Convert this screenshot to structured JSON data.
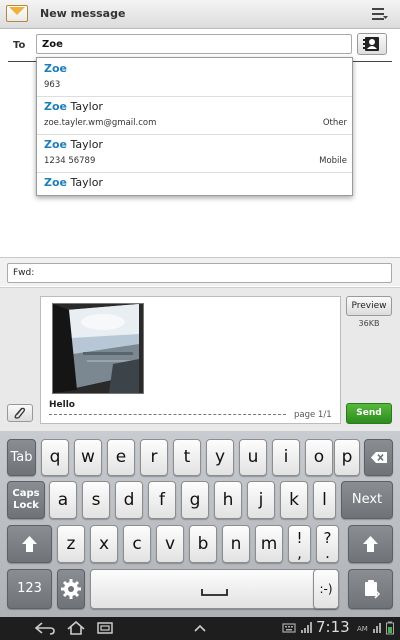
{
  "titlebar": {
    "title": "New message",
    "icon": "envelope-icon",
    "menu_icon": "menu-icon"
  },
  "recipient": {
    "label": "To",
    "value": "Zoe",
    "contacts_icon": "contacts-icon"
  },
  "suggestions": [
    {
      "match": "Zoe",
      "rest": "",
      "detail": "963",
      "type": ""
    },
    {
      "match": "Zoe",
      "rest": " Taylor",
      "detail": "zoe.tayler.wm@gmail.com",
      "type": "Other"
    },
    {
      "match": "Zoe",
      "rest": " Taylor",
      "detail": "1234 56789",
      "type": "Mobile"
    },
    {
      "match": "Zoe",
      "rest": " Taylor",
      "detail": "",
      "type": ""
    }
  ],
  "subject": {
    "value": "Fwd:"
  },
  "message": {
    "text": "Hello",
    "page_indicator": "page 1/1",
    "attachment_size": "36KB",
    "preview_label": "Preview",
    "send_label": "Send",
    "attach_icon": "paperclip-icon"
  },
  "keyboard": {
    "row1": [
      "q",
      "w",
      "e",
      "r",
      "t",
      "y",
      "u",
      "i",
      "o",
      "p"
    ],
    "row2": [
      "a",
      "s",
      "d",
      "f",
      "g",
      "h",
      "j",
      "k",
      "l"
    ],
    "row3": [
      "z",
      "x",
      "c",
      "v",
      "b",
      "n",
      "m"
    ],
    "tab": "Tab",
    "caps_line1": "Caps",
    "caps_line2": "Lock",
    "next": "Next",
    "num": "123",
    "punct1": "!",
    "punct1_alt": ",",
    "punct2": "?",
    "punct2_alt": ".",
    "smiley": ":-)"
  },
  "status": {
    "time": "7:13",
    "ampm": "AM"
  },
  "colors": {
    "send": "#3a9a28",
    "highlight": "#1d7fb8",
    "keyboard": "#b9bdc1"
  }
}
